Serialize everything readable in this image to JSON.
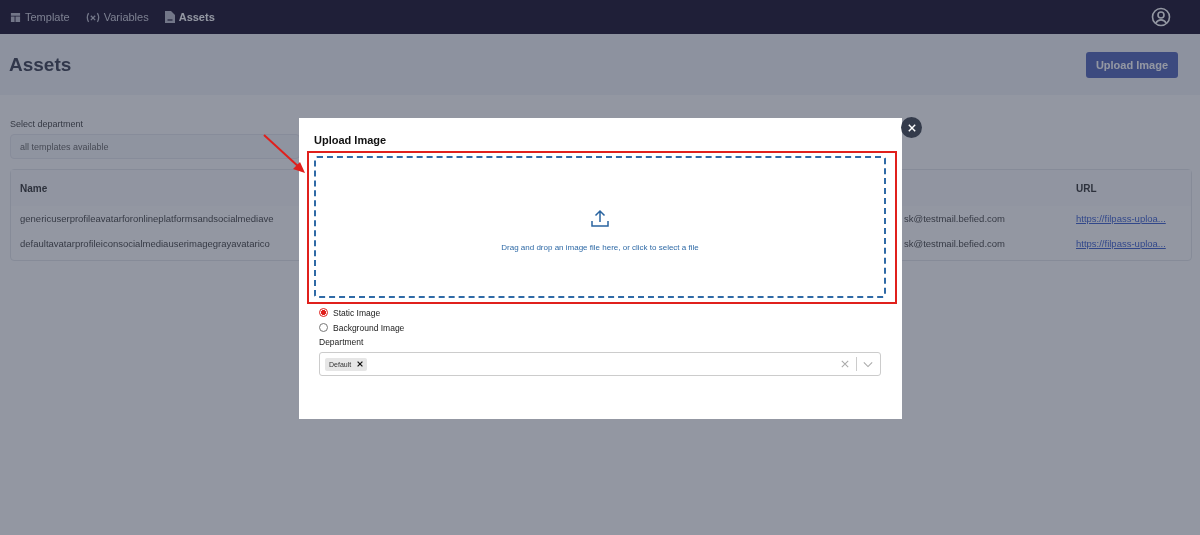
{
  "navbar": {
    "items": [
      {
        "kind": "template",
        "label": "Template",
        "selected": false
      },
      {
        "kind": "variables",
        "label": "Variables",
        "selected": false
      },
      {
        "kind": "assets",
        "label": "Assets",
        "selected": true
      }
    ]
  },
  "header": {
    "title": "Assets",
    "upload_button": "Upload Image"
  },
  "filter": {
    "label": "Select department",
    "placeholder": "all templates available"
  },
  "table": {
    "columns": [
      {
        "label": "Name"
      },
      {
        "label": "URL"
      }
    ],
    "rows": [
      {
        "name": "genericuserprofileavatarforonlineplatformsandsocialmediave",
        "column_2": "sk@testmail.befied.com",
        "url": "https://filpass-uploa..."
      },
      {
        "name": "defaultavatarprofileiconsocialmediauserimagegrayavatarico",
        "column_2": "sk@testmail.befied.com",
        "url": "https://filpass-uploa..."
      }
    ]
  },
  "modal": {
    "title": "Upload Image",
    "dropzone_text": "Drag and drop an image file here, or click to select a file",
    "image_types": [
      {
        "label": "Static Image",
        "selected": true
      },
      {
        "label": "Background Image",
        "selected": false
      }
    ],
    "department_label": "Department",
    "department_tags": [
      {
        "label": "Default"
      }
    ]
  }
}
